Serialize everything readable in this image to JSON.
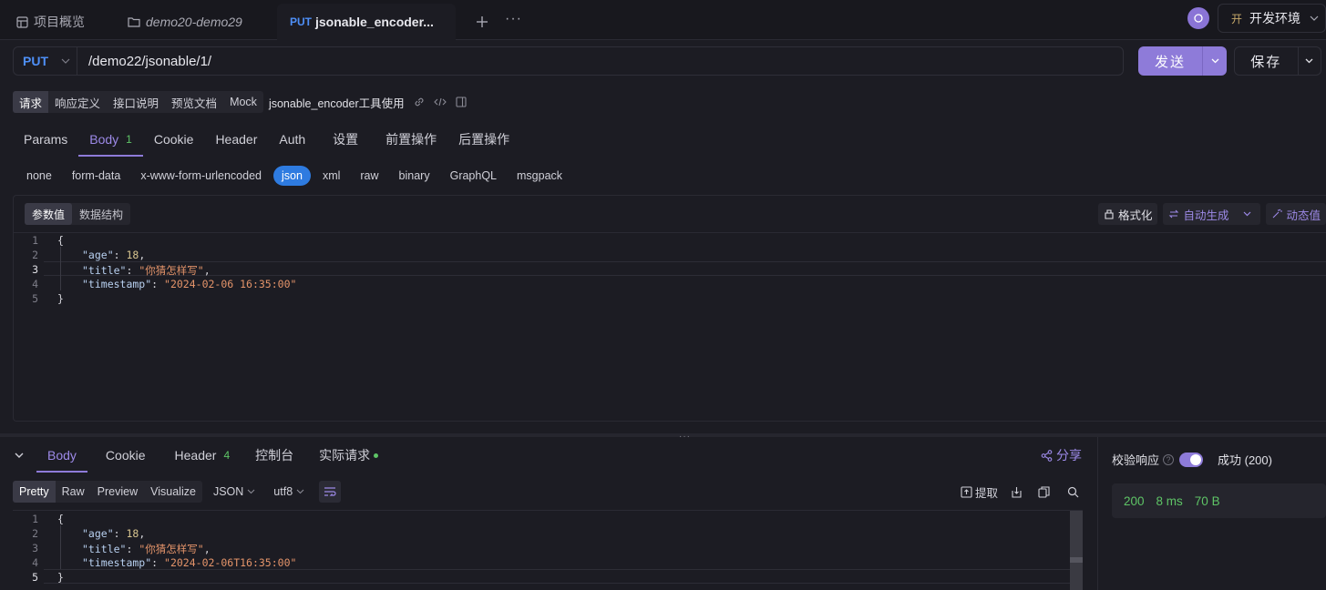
{
  "tabs": [
    {
      "label": "项目概览"
    },
    {
      "label": "demo20-demo29"
    },
    {
      "method": "PUT",
      "label": "jsonable_encoder..."
    }
  ],
  "env": {
    "badge": "开",
    "label": "开发环境"
  },
  "request": {
    "method": "PUT",
    "url": "/demo22/jsonable/1/",
    "send_label": "发送",
    "save_label": "保存"
  },
  "subbar": {
    "items": [
      "请求",
      "响应定义",
      "接口说明",
      "预览文档",
      "Mock"
    ],
    "api_name": "jsonable_encoder工具使用"
  },
  "req_tabs": [
    {
      "label": "Params"
    },
    {
      "label": "Body",
      "count": "1"
    },
    {
      "label": "Cookie"
    },
    {
      "label": "Header"
    },
    {
      "label": "Auth"
    },
    {
      "label": "设置"
    },
    {
      "label": "前置操作"
    },
    {
      "label": "后置操作"
    }
  ],
  "body_types": [
    "none",
    "form-data",
    "x-www-form-urlencoded",
    "json",
    "xml",
    "raw",
    "binary",
    "GraphQL",
    "msgpack"
  ],
  "editor": {
    "toggle": [
      "参数值",
      "数据结构"
    ],
    "format_label": "格式化",
    "autogen_label": "自动生成",
    "dynamic_label": "动态值",
    "line_numbers": [
      "1",
      "2",
      "3",
      "4",
      "5"
    ],
    "lines": {
      "l1": "{",
      "age_key": "\"age\"",
      "age_val": "18",
      "title_key": "\"title\"",
      "title_val": "\"你猜怎样写\"",
      "ts_key": "\"timestamp\"",
      "ts_val": "\"2024-02-06 16:35:00\"",
      "l5": "}"
    }
  },
  "response": {
    "tabs": [
      {
        "label": "Body"
      },
      {
        "label": "Cookie"
      },
      {
        "label": "Header",
        "count": "4"
      },
      {
        "label": "控制台"
      },
      {
        "label": "实际请求"
      }
    ],
    "share_label": "分享",
    "views": [
      "Pretty",
      "Raw",
      "Preview",
      "Visualize"
    ],
    "format": "JSON",
    "encoding": "utf8",
    "extract_label": "提取",
    "line_numbers": [
      "1",
      "2",
      "3",
      "4",
      "5"
    ],
    "lines": {
      "l1": "{",
      "age_key": "\"age\"",
      "age_val": "18",
      "title_key": "\"title\"",
      "title_val": "\"你猜怎样写\"",
      "ts_key": "\"timestamp\"",
      "ts_val": "\"2024-02-06T16:35:00\"",
      "l5": "}"
    },
    "validate_label": "校验响应",
    "validate_result": "成功 (200)",
    "status": "200",
    "time": "8 ms",
    "size": "70 B"
  },
  "colors": {
    "accent": "#8e7bd9",
    "method": "#4e8ff7",
    "success": "#5ec466",
    "json_active": "#2e7be0"
  }
}
